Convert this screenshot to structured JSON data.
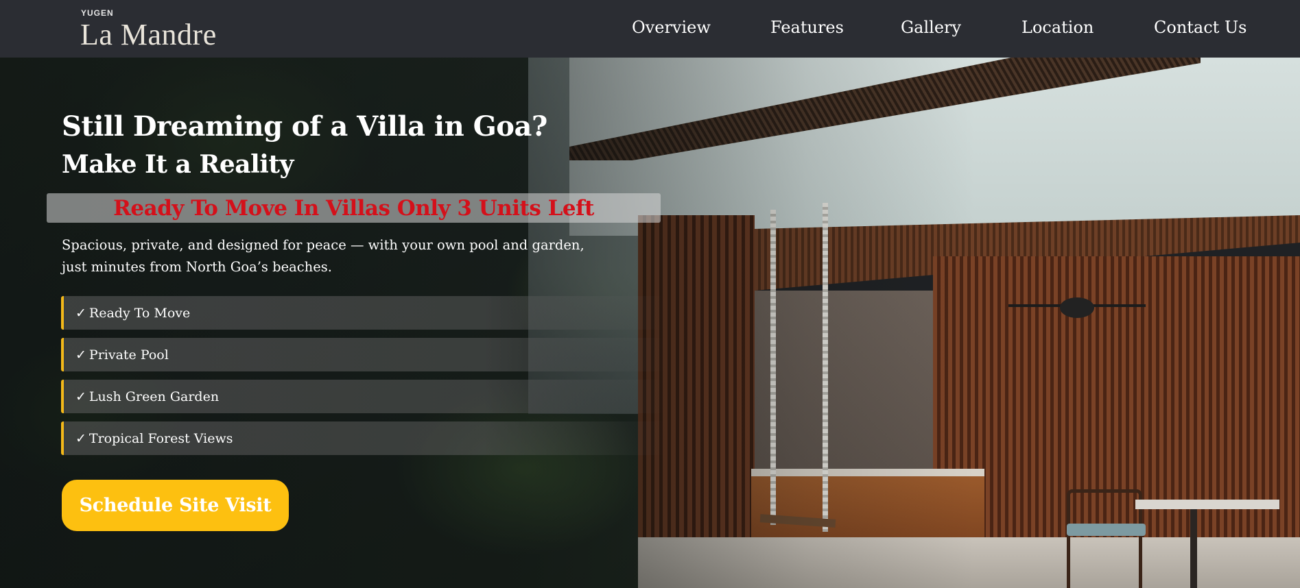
{
  "header": {
    "logo_brand": "YUGEN",
    "logo_name": "La Mandre",
    "nav": [
      {
        "label": "Overview"
      },
      {
        "label": "Features"
      },
      {
        "label": "Gallery"
      },
      {
        "label": "Location"
      },
      {
        "label": "Contact Us"
      }
    ]
  },
  "hero": {
    "headline": "Still Dreaming of a Villa in Goa?",
    "subheadline": "Make It a Reality",
    "banner": "Ready To Move In Villas Only 3 Units Left",
    "description": "Spacious, private, and designed for peace — with your own pool and garden, just minutes from North Goa’s beaches.",
    "check_symbol": "✓",
    "features": [
      {
        "label": "Ready To Move"
      },
      {
        "label": "Private Pool"
      },
      {
        "label": "Lush Green Garden"
      },
      {
        "label": "Tropical Forest Views"
      }
    ],
    "cta_label": "Schedule Site Visit"
  },
  "colors": {
    "header_bg": "#2b2d33",
    "banner_text": "#d4101a",
    "accent_yellow": "#fdc010",
    "feature_border": "#f4b91a"
  }
}
